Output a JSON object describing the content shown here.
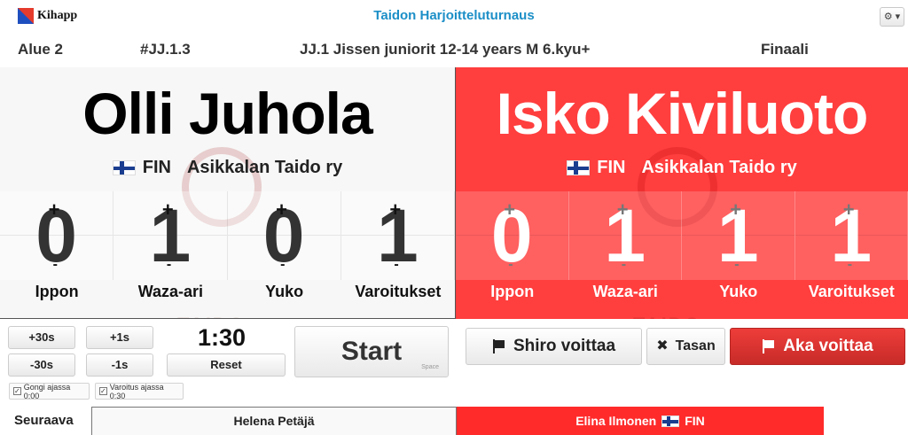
{
  "app": {
    "logo_text": "Kihapp",
    "title": "Taidon Harjoitteluturnaus",
    "settings_icon": "gear-icon",
    "settings_label": "⚙ ▾"
  },
  "match": {
    "area": "Alue 2",
    "match_id": "#JJ.1.3",
    "category": "JJ.1 Jissen juniorit 12-14 years M 6.kyu+",
    "round": "Finaali"
  },
  "white": {
    "name": "Olli Juhola",
    "country": "FIN",
    "club": "Asikkalan Taido ry",
    "scores": [
      "0",
      "1",
      "0",
      "1"
    ],
    "score_labels": [
      "Ippon",
      "Waza-ari",
      "Yuko",
      "Varoitukset"
    ]
  },
  "red": {
    "name": "Isko Kiviluoto",
    "country": "FIN",
    "club": "Asikkalan Taido ry",
    "scores": [
      "0",
      "1",
      "1",
      "1"
    ],
    "score_labels": [
      "Ippon",
      "Waza-ari",
      "Yuko",
      "Varoitukset"
    ]
  },
  "controls": {
    "plus30": "+30s",
    "minus30": "-30s",
    "plus1": "+1s",
    "minus1": "-1s",
    "timer": "1:30",
    "reset": "Reset",
    "start": "Start",
    "start_hint": "Space",
    "shiro": "Shiro voittaa",
    "tasan": "Tasan",
    "aka": "Aka voittaa",
    "gong": "Gongi ajassa 0:00",
    "warning": "Varoitus ajassa 0:30"
  },
  "next": {
    "label": "Seuraava",
    "white": "Helena Petäjä",
    "red_name": "Elina Ilmonen",
    "red_country": "FIN"
  },
  "colors": {
    "accent": "#1c8fc7",
    "aka": "#ff3e3e",
    "shiro": "#f7f7f7"
  }
}
